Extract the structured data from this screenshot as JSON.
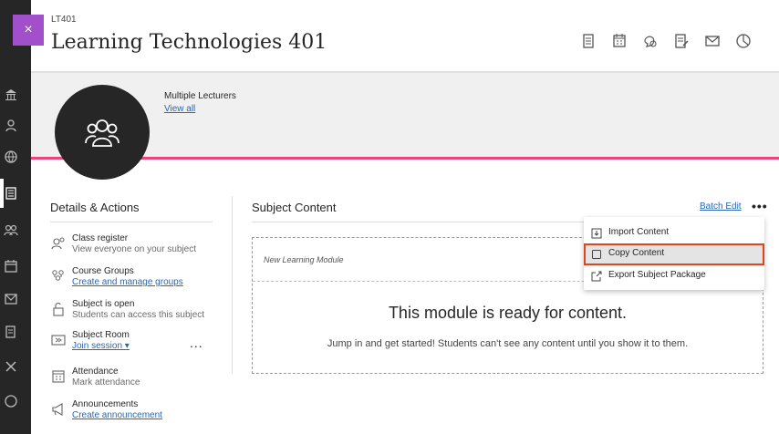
{
  "header": {
    "course_code": "LT401",
    "course_title": "Learning Technologies 401",
    "close_label": "×"
  },
  "banner": {
    "lecturers": "Multiple Lecturers",
    "view_all": "View all"
  },
  "details": {
    "title": "Details & Actions",
    "actions": [
      {
        "title": "Class register",
        "sub": "View everyone on your subject"
      },
      {
        "title": "Course Groups",
        "link": "Create and manage groups"
      },
      {
        "title": "Subject is open",
        "sub": "Students can access this subject"
      },
      {
        "title": "Subject Room",
        "link": "Join session ▾"
      },
      {
        "title": "Attendance",
        "sub": "Mark attendance"
      },
      {
        "title": "Announcements",
        "link": "Create announcement"
      }
    ],
    "more": "..."
  },
  "content": {
    "title": "Subject Content",
    "batch_edit": "Batch Edit",
    "more": "•••",
    "module_name": "New Learning Module",
    "ready": "This module is ready for content.",
    "jump": "Jump in and get started! Students can't see any content until you show it to them."
  },
  "menu": {
    "items": [
      {
        "label": "Import Content"
      },
      {
        "label": "Copy Content"
      },
      {
        "label": "Export Subject Package"
      }
    ]
  },
  "colors": {
    "accent": "#a24fcb",
    "pink": "#e8467c",
    "link": "#2767b5",
    "highlight": "#e0461b"
  }
}
